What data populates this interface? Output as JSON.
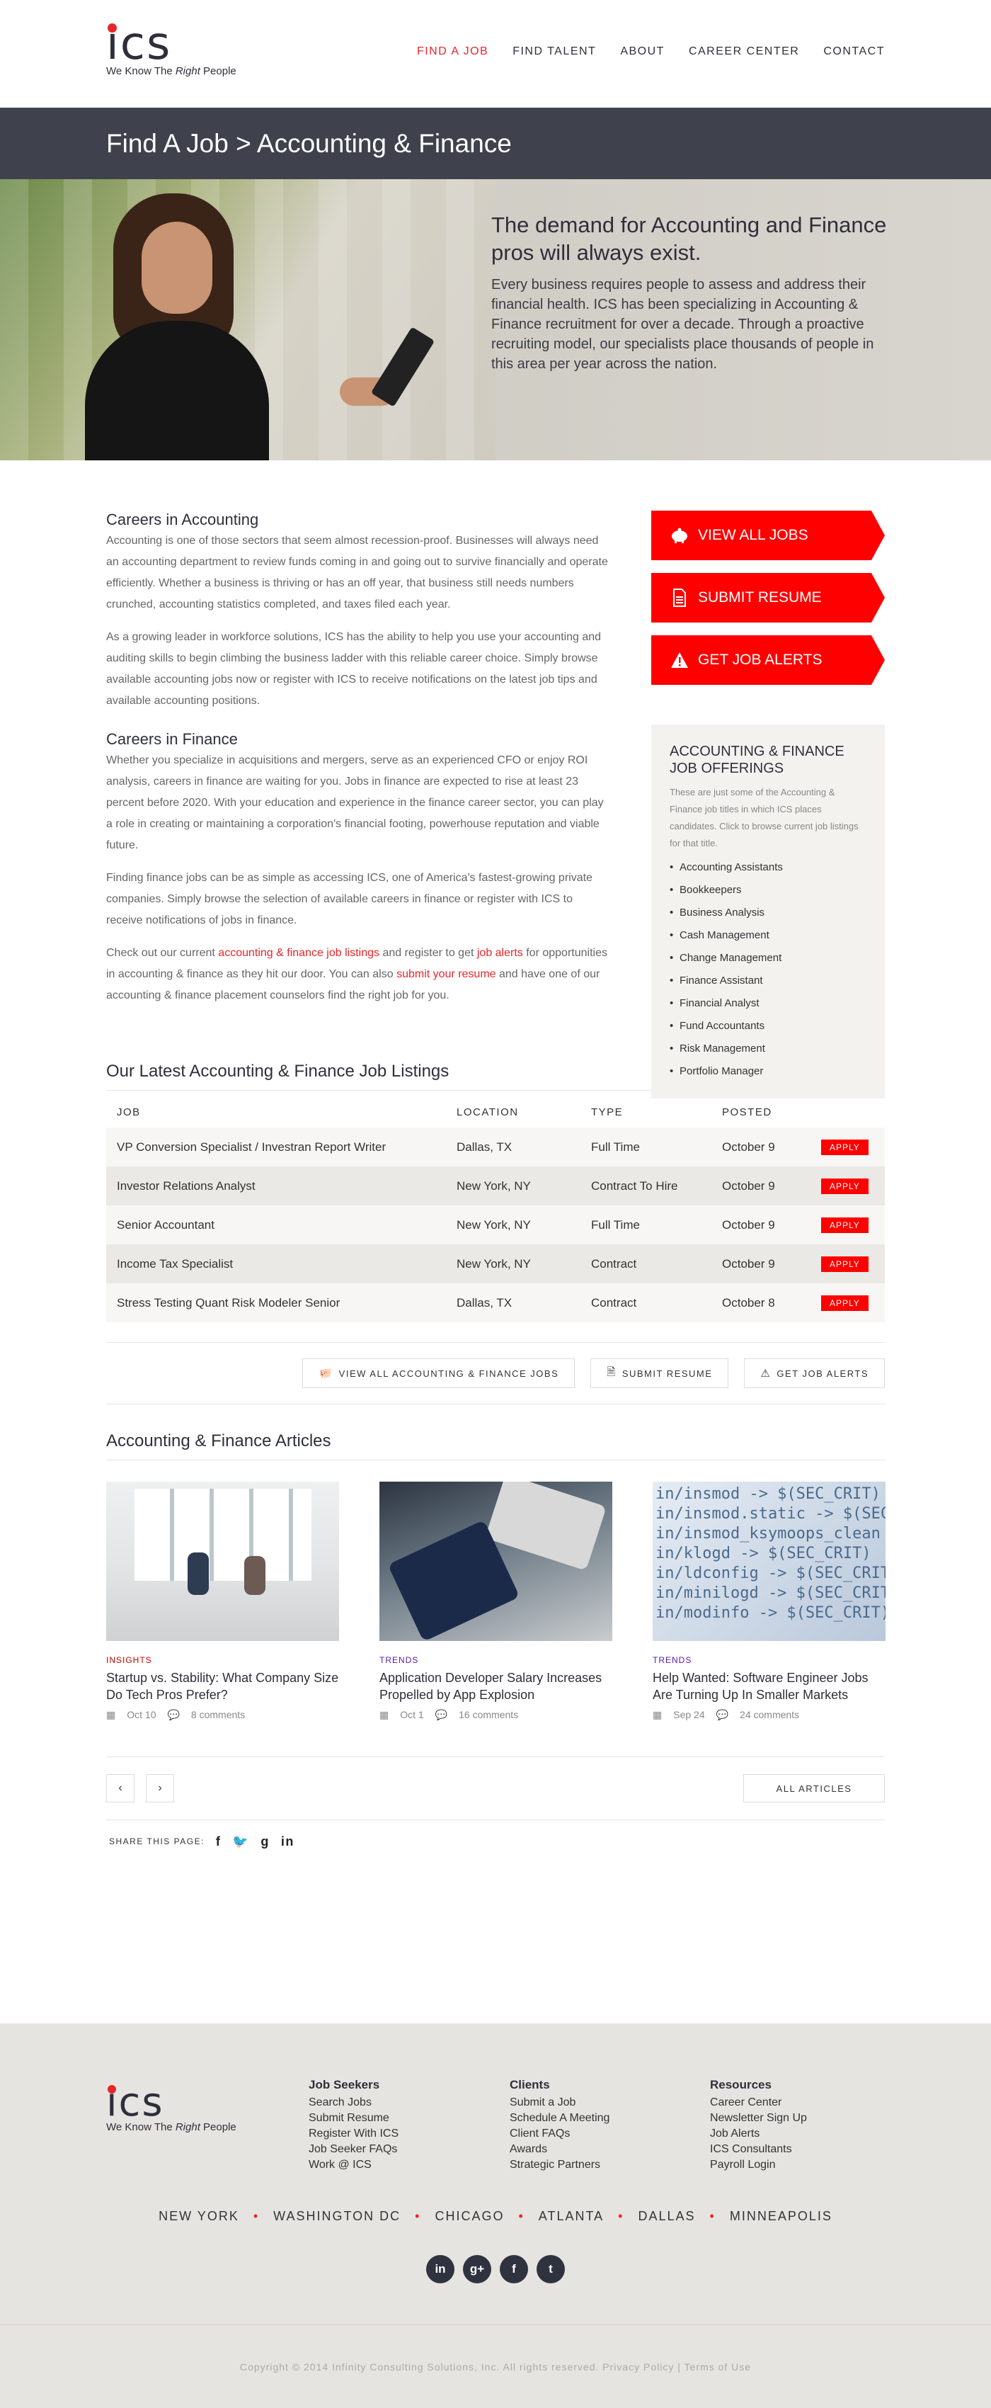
{
  "brand": {
    "logo_text": "ics",
    "tagline_pre": "We Know The ",
    "tagline_em": "Right",
    "tagline_post": " People",
    "accent": "#e8262a"
  },
  "nav": {
    "items": [
      "FIND A JOB",
      "FIND TALENT",
      "ABOUT",
      "CAREER CENTER",
      "CONTACT"
    ]
  },
  "title": {
    "text": "Find A Job > Accounting & Finance"
  },
  "hero": {
    "heading": "The demand for Accounting and Finance pros will always exist.",
    "body": "Every business requires people to assess and address their financial health. ICS has been specializing in Accounting & Finance recruitment for over a decade. Through a proactive recruiting model, our specialists place thousands of people in this area per year across the nation."
  },
  "accounting": {
    "heading": "Careers in Accounting",
    "p1": "Accounting is one of those sectors that seem almost recession-proof. Businesses will always need an accounting department to review funds coming in and going out to survive financially and operate efficiently. Whether a business is thriving or has an off year, that business still needs numbers crunched, accounting statistics completed, and taxes filed each year.",
    "p2": "As a growing leader in workforce solutions, ICS has the ability to help you use your accounting and auditing skills to begin climbing the business ladder with this reliable career choice. Simply browse available accounting jobs now or register with ICS to receive notifications on the latest job tips and available accounting positions."
  },
  "finance": {
    "heading": "Careers in Finance",
    "p1": "Whether you specialize in acquisitions and mergers, serve as an experienced CFO or enjoy ROI analysis, careers in finance are waiting for you. Jobs in finance are expected to rise at least 23 percent before 2020. With your education and experience in the finance career sector, you can play a role in creating or maintaining a corporation's financial footing, powerhouse reputation and viable future.",
    "p2": "Finding finance jobs can be as simple as accessing ICS, one of America's fastest-growing private companies. Simply browse the selection of available careers in finance or register with ICS to receive notifications of jobs in finance.",
    "p3_a": "Check out our current ",
    "link_listings": "accounting & finance job listings",
    "p3_b": " and register to get ",
    "link_alerts": "job alerts",
    "p3_c": " for opportunities in accounting & finance as they hit our door. You can also ",
    "link_resume": "submit your resume",
    "p3_d": " and have one of our accounting & finance placement counselors find the right job for you."
  },
  "cta": {
    "view_all": "VIEW ALL JOBS",
    "submit": "SUBMIT RESUME",
    "alerts": "GET JOB ALERTS"
  },
  "offerings": {
    "title": "ACCOUNTING & FINANCE JOB OFFERINGS",
    "intro": "These are just some of the Accounting & Finance job titles in which ICS places candidates. Click to browse current job listings for that title.",
    "items": [
      "Accounting Assistants",
      "Bookkeepers",
      "Business Analysis",
      "Cash Management",
      "Change Management",
      "Finance Assistant",
      "Financial Analyst",
      "Fund Accountants",
      "Risk Management",
      "Portfolio Manager"
    ]
  },
  "listings": {
    "heading": "Our Latest Accounting & Finance Job Listings",
    "columns": [
      "JOB",
      "LOCATION",
      "TYPE",
      "POSTED"
    ],
    "apply_label": "APPLY",
    "rows": [
      {
        "job": "VP Conversion Specialist / Investran Report Writer",
        "location": "Dallas, TX",
        "type": "Full Time",
        "posted": "October 9"
      },
      {
        "job": "Investor Relations Analyst",
        "location": "New York, NY",
        "type": "Contract To Hire",
        "posted": "October 9"
      },
      {
        "job": "Senior Accountant",
        "location": "New York, NY",
        "type": "Full Time",
        "posted": "October 9"
      },
      {
        "job": "Income Tax Specialist",
        "location": "New York, NY",
        "type": "Contract",
        "posted": "October 9"
      },
      {
        "job": "Stress Testing Quant Risk Modeler Senior",
        "location": "Dallas, TX",
        "type": "Contract",
        "posted": "October 8"
      }
    ],
    "btn_view_all": "VIEW ALL ACCOUNTING & FINANCE JOBS",
    "btn_submit": "SUBMIT RESUME",
    "btn_alerts": "GET JOB ALERTS"
  },
  "articles": {
    "heading": "Accounting & Finance Articles",
    "items": [
      {
        "tag": "INSIGHTS",
        "title": "Startup vs. Stability: What Company Size Do Tech Pros Prefer?",
        "date": "Oct 10",
        "comments": "8 comments"
      },
      {
        "tag": "TRENDS",
        "title": "Application Developer Salary Increases Propelled by App Explosion",
        "date": "Oct 1",
        "comments": "16 comments"
      },
      {
        "tag": "TRENDS",
        "title": "Help Wanted: Software Engineer Jobs Are Turning Up In Smaller Markets",
        "date": "Sep 24",
        "comments": "24 comments"
      }
    ],
    "code_text": "in/insmod -> $(SEC_CRIT)\nin/insmod.static -> $(SEC\nin/insmod_ksymoops_clean -> $\nin/klogd -> $(SEC_CRIT)\nin/ldconfig -> $(SEC_CRIT)\nin/minilogd -> $(SEC_CRIT)\nin/modinfo -> $(SEC_CRIT)",
    "prev": "‹",
    "next": "›",
    "all_label": "ALL ARTICLES",
    "share_label": "SHARE THIS PAGE:"
  },
  "footer": {
    "col1": {
      "title": "Job Seekers",
      "items": [
        "Search Jobs",
        "Submit Resume",
        "Register With ICS",
        "Job Seeker FAQs",
        "Work @ ICS"
      ]
    },
    "col2": {
      "title": "Clients",
      "items": [
        "Submit a Job",
        "Schedule A Meeting",
        "Client FAQs",
        "Awards",
        "Strategic Partners"
      ]
    },
    "col3": {
      "title": "Resources",
      "items": [
        "Career Center",
        "Newsletter Sign Up",
        "Job Alerts",
        "ICS Consultants",
        "Payroll Login"
      ]
    },
    "cities": [
      "NEW YORK",
      "WASHINGTON DC",
      "CHICAGO",
      "ATLANTA",
      "DALLAS",
      "MINNEAPOLIS"
    ],
    "copyright": "Copyright © 2014 Infinity Consulting Solutions, Inc. All rights reserved. Privacy Policy | Terms of Use"
  }
}
